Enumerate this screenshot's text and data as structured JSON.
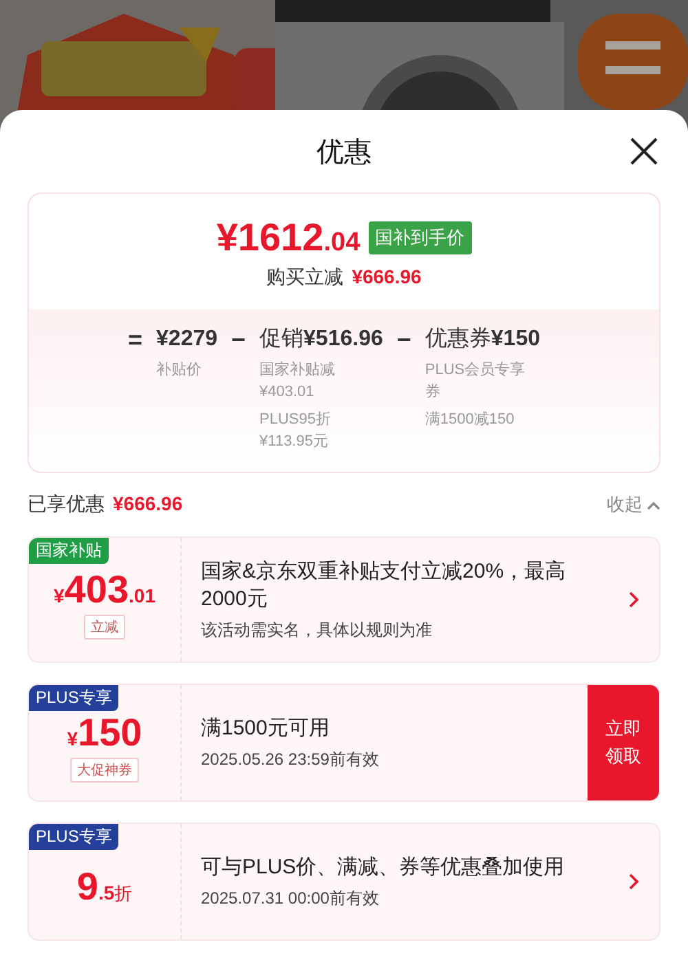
{
  "header": {
    "title": "优惠"
  },
  "summary": {
    "price_main": "¥1612",
    "price_decimal": ".04",
    "price_tag": "国补到手价",
    "saving_label": "购买立减",
    "saving_amount": "¥666.96",
    "breakdown": [
      {
        "operator": "=",
        "amount": "¥2279",
        "notes": [
          [
            "补贴价"
          ]
        ]
      },
      {
        "operator": "−",
        "label": "促销",
        "amount": "¥516.96",
        "notes": [
          [
            "国家补贴减",
            "¥403.01"
          ],
          [
            "PLUS95折",
            "¥113.95元"
          ]
        ]
      },
      {
        "operator": "−",
        "label": "优惠券",
        "amount": "¥150",
        "notes": [
          [
            "PLUS会员专享",
            "券"
          ],
          [
            "满1500减150"
          ]
        ]
      }
    ]
  },
  "enjoyed": {
    "label": "已享优惠",
    "amount": "¥666.96",
    "toggle": "收起",
    "expanded": true
  },
  "offers": [
    {
      "kind": "chevron",
      "badge": "国家补贴",
      "color": "#1f9e45",
      "currency": "¥",
      "integer": "403",
      "decimal": ".01",
      "tag": "立减",
      "title": "国家&京东双重补贴支付立减20%，最高2000元",
      "detail": "该活动需实名，具体以规则为准"
    },
    {
      "kind": "button",
      "badge": "PLUS专享",
      "color": "#25409a",
      "currency": "¥",
      "integer": "150",
      "tag": "大促神券",
      "title": "满1500元可用",
      "detail": "2025.05.26 23:59前有效",
      "action": "立即领取"
    },
    {
      "kind": "chevron",
      "badge": "PLUS专享",
      "color": "#25409a",
      "integer": "9",
      "decimal": ".5",
      "unit": "折",
      "title": "可与PLUS价、满减、券等优惠叠加使用",
      "detail": "2025.07.31 00:00前有效"
    }
  ]
}
